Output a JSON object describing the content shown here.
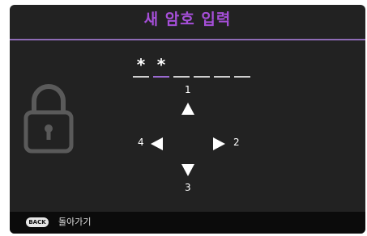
{
  "dialog": {
    "title": "새 암호 입력"
  },
  "password": {
    "slots": [
      "*",
      "*",
      "",
      "",
      "",
      ""
    ],
    "active_index": 1
  },
  "directions": {
    "up_number": "1",
    "right_number": "2",
    "down_number": "3",
    "left_number": "4"
  },
  "footer": {
    "back_badge": "BACK",
    "back_label": "돌아가기"
  },
  "colors": {
    "title": "#a64fd9",
    "accent_rule": "#8d6bb5",
    "background": "#222222"
  },
  "icons": {
    "lock": "lock-icon",
    "arrows": [
      "arrow-up-icon",
      "arrow-right-icon",
      "arrow-down-icon",
      "arrow-left-icon"
    ]
  }
}
